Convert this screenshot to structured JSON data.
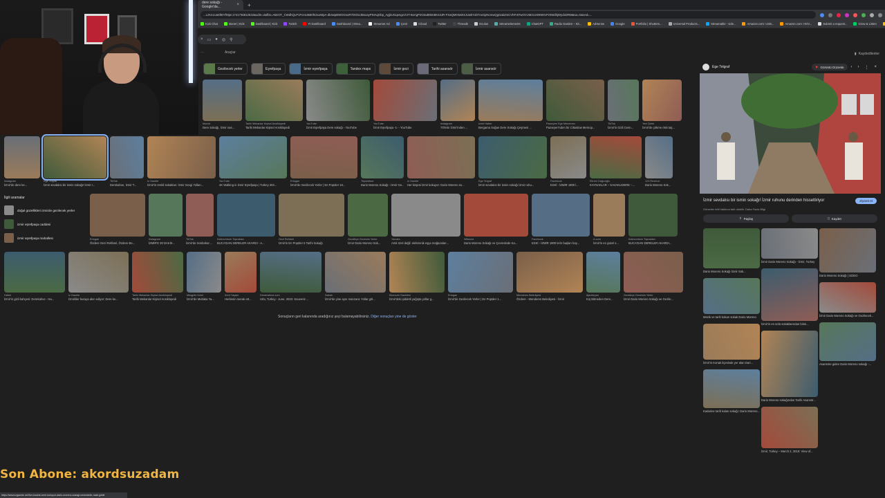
{
  "browser": {
    "tab_title": "dere sokağı - Google'da...",
    "url": "...LzKn1Ua5fIDYfMjw:1741736812522&udm=2&fbs=ABzOT_CWdhQLP1FcmU5B0fn3xuWpA-dk4wpBWOGsoR7DG5zJBsxayPSIAqObp_AgjkUGqengxVrJT-9aAgP2O2uBt9mBK44JR-FXaQMHtuW4JUwkYxbTnxGpNcmwQgGakZmCVhFr87wOVUM2UcWIW0cPz0WdhjWydxDRM&sa=X&ved=...",
    "bookmarks": [
      "Kick Chat",
      "stonet | Kick",
      "Dashboard | Kick",
      "Twitch",
      "Yt Dashboard",
      "Dashboard | Strea...",
      "Streamer Ad",
      "Çevir",
      "iCloud",
      "Twitter",
      "Threads",
      "Oculus",
      "Streamelements",
      "ChatGPT",
      "Radio Garden – Kit...",
      "AdSense",
      "Google",
      "Portfolio | Shutters...",
      "Universal Products...",
      "Streamable - vide...",
      "Amazon.com: USB...",
      "Amazon.com: HOV...",
      "Submit a request...",
      "Grow & Listen",
      "Tüm Yer İşaretleri"
    ]
  },
  "toolbar": {
    "tools_label": "Araçlar",
    "saved_label": "Kaydedilenler"
  },
  "chips": [
    "Gezilecek yerler",
    "Eşrefpaşa",
    "İzmir eşrefpaşa",
    "Tandex maps",
    "İzmir gezi",
    "Tarihi asansör",
    "İzmir asansör"
  ],
  "row1": [
    {
      "src": "Moovit",
      "cap": "Dere Sokağı, İzmir nas..."
    },
    {
      "src": "Tarihi Mekanlar Kişisel Ansiklopedi",
      "cap": "Tarihi Mekanlar Kişisel Ansiklopedi"
    },
    {
      "src": "YouTube",
      "cap": "İzmir Eşrefpaşa Dere sokağı - YouTube"
    },
    {
      "src": "YouTube",
      "cap": "İzmir Eşrefpaşa -1- - YouTube"
    },
    {
      "src": "Instagram",
      "cap": "70'lerin İzmir'inden ..."
    },
    {
      "src": "İzmir Haber",
      "cap": "Bergama Soğan Dere Sokağı Çeşmesi ..."
    },
    {
      "src": "Pazaryeri Ege Menemen",
      "cap": "Pazaryeri'nden bir Cittaslow Memop..."
    },
    {
      "src": "TikTok",
      "cap": "İzmir'in Gizli Cenn..."
    },
    {
      "src": "Yeni Şehir",
      "cap": "İzmir'de çökme riski taş..."
    }
  ],
  "row2": [
    {
      "src": "Instagram",
      "cap": "İzmir'de dere ke..."
    },
    {
      "src": "Ege Telgraf",
      "cap": "İzmir sevdalısı bir ismin sokağı! İzmir r..."
    },
    {
      "src": "TikTok",
      "cap": "Derekahve, İzmir T..."
    },
    {
      "src": "İz Gazete",
      "cap": "İzmir'in renkli sokakları: İzmir Sevgi Yolları..."
    },
    {
      "src": "YouTube",
      "cap": "4K Walking in İzmir Eşrefpaşa | Turkey 202..."
    },
    {
      "src": "Ertugan",
      "cap": "İzmir'de Gezilecek Yerler | En Popüler 10..."
    },
    {
      "src": "Tripadvisor",
      "cap": "Dario Moreno Sokağı - İzmir Ge..."
    },
    {
      "src": "İz Gazete",
      "cap": "Her köşesi İzmir kokuyor: Dario Moreno so..."
    },
    {
      "src": "Ege Telgraf",
      "cap": "İzmir sevdalısı bir ismin sokağı İzmir ruhu..."
    },
    {
      "src": "Facebook",
      "cap": "ESKİ - İZMİR 1900 l..."
    },
    {
      "src": "Ekrem Dağcıoğlu",
      "cap": "KAYNAKLAR – KAVAKLIDERE –..."
    },
    {
      "src": "123 Rezerve",
      "cap": "Dario Moreno Sok..."
    }
  ],
  "row3": [
    {
      "src": "Ertugan",
      "cap": "Özdere Gezi Rehberi, Özdere Be..."
    },
    {
      "src": "Instagram",
      "cap": "İZMİR'E 30 DAKİK..."
    },
    {
      "src": "TikTok",
      "cap": "İzmir'de Sonbahar ..."
    },
    {
      "src": "Kalecontrum Toprakları",
      "cap": "BUCA'DAN DERELER AKARDI - A..."
    },
    {
      "src": "Gezi Rehberi",
      "cap": "İzmir'in En Popüler 5 Tarihi Sokağı"
    },
    {
      "src": "Gezdikçe Gezesim Yerler",
      "cap": "İzmir Dario Moreno Sok..."
    },
    {
      "src": "Yandex",
      "cap": "Artık özel değil: elektronik eşya mağazaları..."
    },
    {
      "src": "Wilsonie",
      "cap": "Dario Moreno Sokağı ve Çevresinde Ka..."
    },
    {
      "src": "Facebook",
      "cap": "ESKİ - İZMİR 1900 lerin başları boy..."
    },
    {
      "src": "A.com",
      "cap": "İzmir'in en güzel s..."
    },
    {
      "src": "Kalecontrum Toprakları",
      "cap": "BUCA'DAN DERELER AKARDI..."
    }
  ],
  "row4": [
    {
      "src": "Habeİ",
      "cap": "İzmir'in gizli bahçesi: Derekahve - Ha..."
    },
    {
      "src": "İz Gazete",
      "cap": "İzmirliler buraya akın ediyor: Dere ke..."
    },
    {
      "src": "Tarihi Mekanlar Kişisel Ansiklopedi",
      "cap": "Tarihi Mekanlar Kişisel Ansiklopedi"
    },
    {
      "src": "Meşgûle Üzmi",
      "cap": "İzmir'de Mutlaka Ya..."
    },
    {
      "src": "Kent Yaşam",
      "cap": "Herkesin merak ett..."
    },
    {
      "src": "Dreamstime.com",
      "cap": "Urla, Turkey - June, 2023: Souvenir ..."
    },
    {
      "src": "Sabah",
      "cap": "İzmir'de yine aynı manzara: Yollar göl..."
    },
    {
      "src": "Ekonomi Gazetesi",
      "cap": "İzmir'deki şiddetli yağışta yollar g..."
    },
    {
      "src": "Ertugan",
      "cap": "İzmir'de Gezilecek Yerler | En Popüler 1..."
    },
    {
      "src": "Menderes Belediyesi",
      "cap": "Özdere - Menderes Belediyesi - İzmir"
    },
    {
      "src": "Ajanbeyan",
      "cap": "Kış Bitmeden Dere..."
    },
    {
      "src": "Gezdikçe Gezesim Yerler",
      "cap": "İzmir Dario Moreno Sokağı ve Gezile..."
    }
  ],
  "related": {
    "title": "İlgili aramalar",
    "items": [
      "doğal güzellikleri izmirde gezilecek yerler",
      "izmir eşrefpaşa caddesi",
      "izmir eşrefpaşa mahallesi"
    ]
  },
  "end_note": {
    "text": "Sonuçların geri kalanında aradığınız şeyi bulamayabilirsiniz.",
    "link": "Diğer sonuçları yine de göster"
  },
  "panel": {
    "source": "Ege Telgraf",
    "badge": "Görüntü Düzenle",
    "title": "İzmir sevdalısı bir ismin sokağı! İzmir ruhunu derinden hissettiriyor",
    "subtitle": "Görseller telif hakkına tabi olabilir. Daha Fazla Bilgi",
    "visit": "Ziyaret et",
    "share": "Paylaş",
    "save": "Kaydet",
    "related_captions": [
      "Dario Moreno Sokağı İzmir Sok...",
      "Müzik ve tarih kokan sokak Dario Moreno",
      "İzmir Dario Moreno Sokağı - İzmir, Turkey",
      "Dario Moreno Sokağı | GDDO",
      "İzmir'in en ünlü sokaklarından birisi...",
      "İzmir Dario Moreno Sokağı ve Gezilecek...",
      "İzmir'in Konak ilçesinde yer alan Dari...",
      "Dario Moreno sokağından Tarihi Asansör...",
      "Asansöre giden Dario Moreno sokağı -...",
      "Kadarine tarih kalan sokağı: Dario Moreno...",
      "İzmir, Turkey – March 2, 2019: View of..."
    ]
  },
  "overlay": {
    "subscriber": "Son Abone: akordsuzadam"
  },
  "statusbar": "https://www.izgazete.net/her-kosesi-izmir-kokuyor-dario-moreno-sokagi-nereededir-nasil-gidilir"
}
